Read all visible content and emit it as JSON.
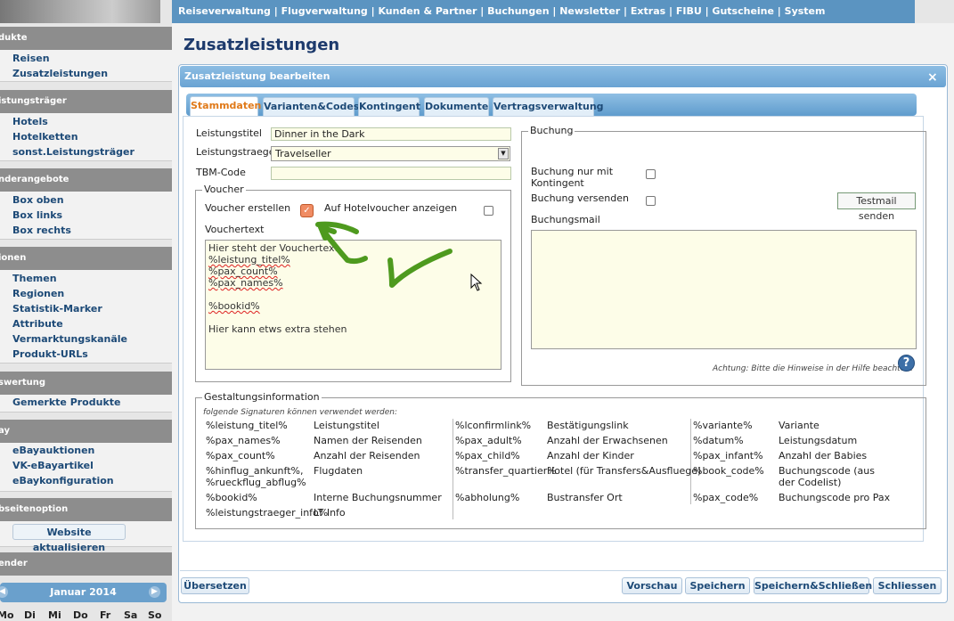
{
  "topnav": "Reiseverwaltung | Flugverwaltung | Kunden & Partner | Buchungen | Newsletter | Extras | FIBU | Gutscheine | System",
  "sidebar": {
    "sections": [
      {
        "title": "dukte",
        "items": [
          "Reisen",
          "Zusatzleistungen"
        ]
      },
      {
        "title": "istungsträger",
        "items": [
          "Hotels",
          "Hotelketten",
          "sonst.Leistungsträger"
        ]
      },
      {
        "title": "nderangebote",
        "items": [
          "Box oben",
          "Box links",
          "Box rechts"
        ]
      },
      {
        "title": "ionen",
        "items": [
          "Themen",
          "Regionen",
          "Statistik-Marker",
          "Attribute",
          "Vermarktungskanäle",
          "Produkt-URLs"
        ]
      },
      {
        "title": "swertung",
        "items": [
          "Gemerkte Produkte"
        ]
      },
      {
        "title": "ay",
        "items": [
          "eBayauktionen",
          "VK-eBayartikel",
          "eBaykonfiguration"
        ]
      },
      {
        "title": "bseitenoption",
        "items": []
      },
      {
        "title": "ender",
        "items": []
      }
    ],
    "website_button": "Website aktualisieren",
    "calendar": {
      "month": "Januar 2014",
      "prev": "◀",
      "next": "▶",
      "days": [
        "Mo",
        "Di",
        "Mi",
        "Do",
        "Fr",
        "Sa",
        "So"
      ]
    }
  },
  "page": {
    "title": "Zusatzleistungen"
  },
  "dialog": {
    "title": "Zusatzleistung bearbeiten",
    "close": "×",
    "tabs": [
      "Stammdaten",
      "Varianten&Codes",
      "Kontingent",
      "Dokumente",
      "Vertragsverwaltung"
    ],
    "active_tab": "Stammdaten",
    "form": {
      "leistungstitel_label": "Leistungstitel",
      "leistungstitel_value": "Dinner in the Dark",
      "leistungstraeger_label": "Leistungstraeger",
      "leistungstraeger_value": "Travelseller",
      "tbm_label": "TBM-Code",
      "tbm_value": ""
    },
    "voucher": {
      "legend": "Voucher",
      "erstellen_label": "Voucher erstellen",
      "erstellen_checked": true,
      "hotel_label": "Auf Hotelvoucher anzeigen",
      "hotel_checked": false,
      "text_label": "Vouchertext",
      "text_lines": [
        "Hier steht der Vouchertext",
        "%leistung_titel%",
        "%pax_count%",
        "%pax_names%",
        "",
        "%bookid%",
        "",
        "Hier kann etws extra stehen"
      ]
    },
    "buchung": {
      "legend": "Buchung",
      "nur_kontingent_label": "Buchung nur mit Kontingent",
      "versenden_label": "Buchung versenden",
      "testmail_button": "Testmail senden",
      "mail_label": "Buchungsmail",
      "mail_value": "",
      "note": "Achtung: Bitte die Hinweise in der Hilfe beachten.",
      "help": "?"
    },
    "gestaltung": {
      "legend": "Gestaltungsinformation",
      "note": "folgende Signaturen können verwendet werden:",
      "col1": [
        {
          "sig": "%leistung_titel%",
          "desc": "Leistungstitel"
        },
        {
          "sig": "%pax_names%",
          "desc": "Namen der Reisenden"
        },
        {
          "sig": "%pax_count%",
          "desc": "Anzahl der Reisenden"
        },
        {
          "sig": "%hinflug_ankunft%, %rueckflug_abflug%",
          "desc": "Flugdaten"
        },
        {
          "sig": "%bookid%",
          "desc": "Interne Buchungsnummer"
        },
        {
          "sig": "%leistungstraeger_info%",
          "desc": "LT Info"
        }
      ],
      "col2": [
        {
          "sig": "%lconfirmlink%",
          "desc": "Bestätigungslink"
        },
        {
          "sig": "%pax_adult%",
          "desc": "Anzahl der Erwachsenen"
        },
        {
          "sig": "%pax_child%",
          "desc": "Anzahl der Kinder"
        },
        {
          "sig": "%transfer_quartier%",
          "desc": "Hotel (für Transfers&Ausfluege)"
        },
        {
          "sig": "%abholung%",
          "desc": "Bustransfer Ort"
        }
      ],
      "col3": [
        {
          "sig": "%variante%",
          "desc": "Variante"
        },
        {
          "sig": "%datum%",
          "desc": "Leistungsdatum"
        },
        {
          "sig": "%pax_infant%",
          "desc": "Anzahl der Babies"
        },
        {
          "sig": "%book_code%",
          "desc": "Buchungscode (aus der Codelist)"
        },
        {
          "sig": "%pax_code%",
          "desc": "Buchungscode pro Pax"
        }
      ]
    },
    "buttons": {
      "uebersetzen": "Übersetzen",
      "vorschau": "Vorschau",
      "speichern": "Speichern",
      "speichern_schliessen": "Speichern&Schließen",
      "schliessen": "Schliessen"
    }
  },
  "colors": {
    "topnav": "#5b94c1",
    "sidebar_head": "#8d8d8d",
    "link": "#1d4a77",
    "active_tab": "#e07a1a",
    "annotation": "#4e9a1e"
  }
}
